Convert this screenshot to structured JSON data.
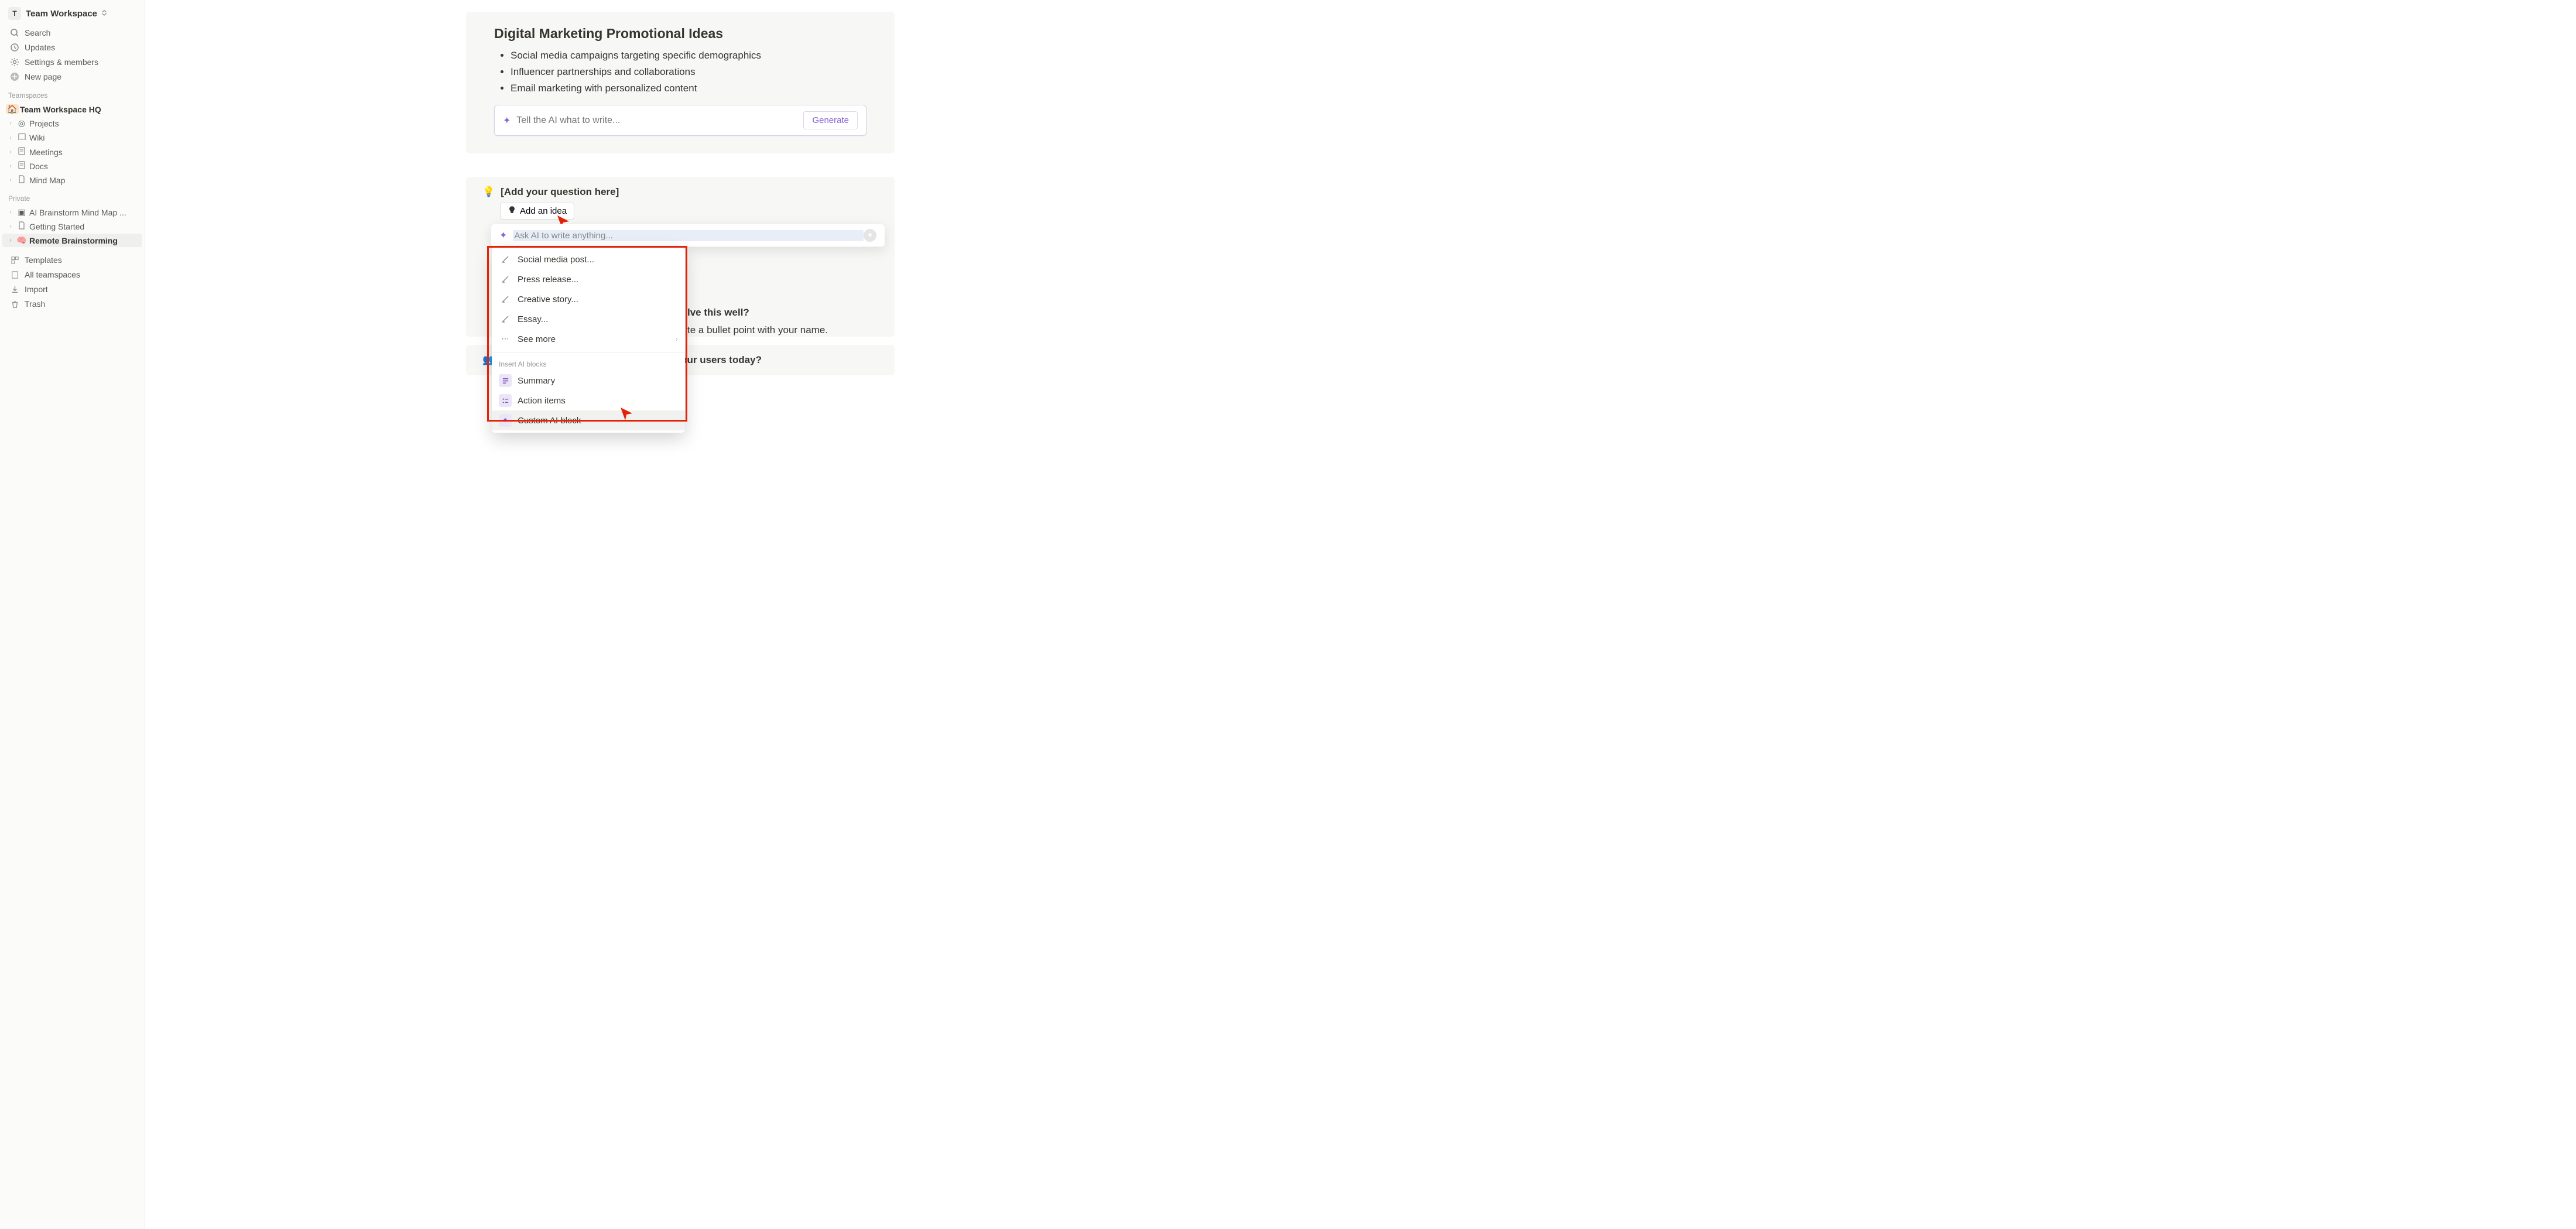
{
  "workspace": {
    "badge": "T",
    "name": "Team Workspace"
  },
  "sidebarTop": {
    "search": "Search",
    "updates": "Updates",
    "settings": "Settings & members",
    "newPage": "New page"
  },
  "teamspacesLabel": "Teamspaces",
  "teamspaces": [
    {
      "icon": "🏠",
      "label": "Team Workspace HQ",
      "bold": true
    },
    {
      "icon": "◎",
      "label": "Projects"
    },
    {
      "icon": "📖",
      "label": "Wiki"
    },
    {
      "icon": "📄",
      "label": "Meetings"
    },
    {
      "icon": "📄",
      "label": "Docs"
    },
    {
      "icon": "📄",
      "label": "Mind Map"
    }
  ],
  "privateLabel": "Private",
  "private": [
    {
      "icon": "▣",
      "label": "AI Brainstorm Mind Map ..."
    },
    {
      "icon": "📄",
      "label": "Getting Started"
    },
    {
      "icon": "🧠",
      "label": "Remote Brainstorming",
      "active": true
    }
  ],
  "sidebarBottom": {
    "templates": "Templates",
    "allTeamspaces": "All teamspaces",
    "import": "Import",
    "trash": "Trash"
  },
  "marketing": {
    "title": "Digital Marketing Promotional Ideas",
    "bullets": [
      "Social media campaigns targeting specific demographics",
      "Influencer partnerships and collaborations",
      "Email marketing with personalized content"
    ],
    "aiPlaceholder": "Tell the AI what to write...",
    "generateLabel": "Generate"
  },
  "question": {
    "emoji": "💡",
    "placeholder": "[Add your question here]",
    "addIdea": "Add an idea",
    "aiWritePlaceholder": "Ask AI to write anything..."
  },
  "dropdown": {
    "writeItems": [
      "Social media post...",
      "Press release...",
      "Creative story...",
      "Essay..."
    ],
    "seeMore": "See more",
    "insertHeading": "Insert AI blocks",
    "blocks": [
      {
        "label": "Summary"
      },
      {
        "label": "Action items"
      },
      {
        "label": "Custom AI block",
        "hovered": true
      }
    ]
  },
  "behindTexts": {
    "solveQuestion": "lve this well?",
    "bulletLine": "te a bullet point with your name."
  },
  "problems": {
    "emoji": "👥",
    "title": "What are the biggest problems facing our users today?"
  }
}
